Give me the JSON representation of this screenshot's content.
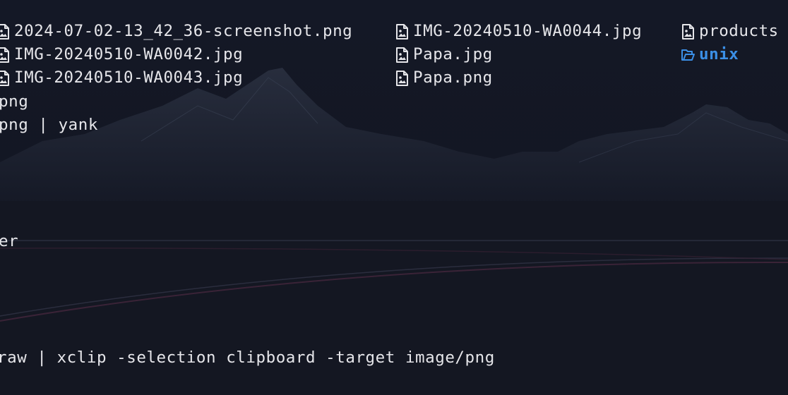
{
  "listing": {
    "columns": [
      [
        {
          "name": "2024-07-02-13_42_36-screenshot.png",
          "icon": "image-file-icon"
        },
        {
          "name": "IMG-20240510-WA0042.jpg",
          "icon": "image-file-icon"
        },
        {
          "name": "IMG-20240510-WA0043.jpg",
          "icon": "image-file-icon"
        }
      ],
      [
        {
          "name": "IMG-20240510-WA0044.jpg",
          "icon": "image-file-icon"
        },
        {
          "name": "Papa.jpg",
          "icon": "image-file-icon"
        },
        {
          "name": "Papa.png",
          "icon": "image-file-icon"
        }
      ],
      [
        {
          "name": "products",
          "icon": "image-file-icon"
        },
        {
          "name": "unix",
          "icon": "folder-icon"
        }
      ]
    ]
  },
  "terminal": {
    "line_png": "png",
    "line_png_yank": "png | yank",
    "line_er": "er",
    "line_xclip": "raw | xclip -selection clipboard -target image/png"
  },
  "colors": {
    "background": "#121520",
    "text": "#e6e6ea",
    "directory": "#3b8fe6"
  }
}
